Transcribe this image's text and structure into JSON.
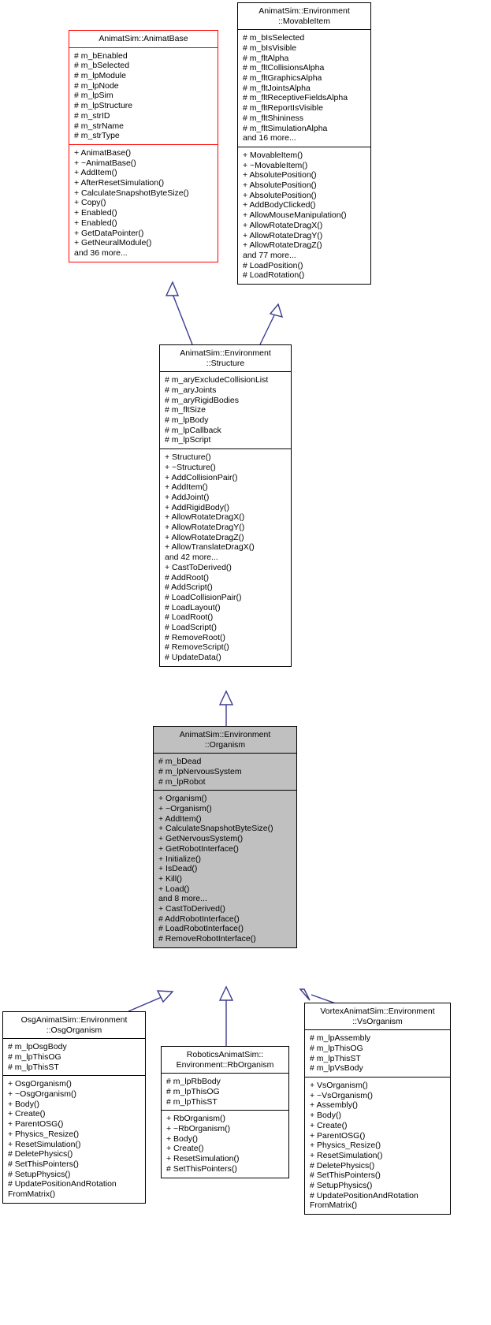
{
  "diagram": {
    "type": "uml-class-inheritance",
    "title": "AnimatSim Organism class hierarchy",
    "colors": {
      "highlight_border": "#ff0000",
      "highlight_fill": "#c0c0c0",
      "edge": "#3b3b8f",
      "box_border": "#000000",
      "box_fill": "#ffffff"
    }
  },
  "classes": [
    {
      "id": "animatbase",
      "name": "AnimatSim::AnimatBase",
      "style": "red-border",
      "attributes": [
        "# m_bEnabled",
        "# m_bSelected",
        "# m_lpModule",
        "# m_lpNode",
        "# m_lpSim",
        "# m_lpStructure",
        "# m_strID",
        "# m_strName",
        "# m_strType"
      ],
      "methods": [
        "+ AnimatBase()",
        "+ ~AnimatBase()",
        "+ AddItem()",
        "+ AfterResetSimulation()",
        "+ CalculateSnapshotByteSize()",
        "+ Copy()",
        "+ Enabled()",
        "+ Enabled()",
        "+ GetDataPointer()",
        "+ GetNeuralModule()",
        "and 36 more..."
      ]
    },
    {
      "id": "movableitem",
      "name": "AnimatSim::Environment\n::MovableItem",
      "style": "plain",
      "attributes": [
        "# m_bIsSelected",
        "# m_bIsVisible",
        "# m_fltAlpha",
        "# m_fltCollisionsAlpha",
        "# m_fltGraphicsAlpha",
        "# m_fltJointsAlpha",
        "# m_fltReceptiveFieldsAlpha",
        "# m_fltReportIsVisible",
        "# m_fltShininess",
        "# m_fltSimulationAlpha",
        "and 16 more..."
      ],
      "methods": [
        "+ MovableItem()",
        "+ ~MovableItem()",
        "+ AbsolutePosition()",
        "+ AbsolutePosition()",
        "+ AbsolutePosition()",
        "+ AddBodyClicked()",
        "+ AllowMouseManipulation()",
        "+ AllowRotateDragX()",
        "+ AllowRotateDragY()",
        "+ AllowRotateDragZ()",
        "and 77 more...",
        "# LoadPosition()",
        "# LoadRotation()"
      ]
    },
    {
      "id": "structure",
      "name": "AnimatSim::Environment\n::Structure",
      "style": "plain",
      "attributes": [
        "# m_aryExcludeCollisionList",
        "# m_aryJoints",
        "# m_aryRigidBodies",
        "# m_fltSize",
        "# m_lpBody",
        "# m_lpCallback",
        "# m_lpScript"
      ],
      "methods": [
        "+ Structure()",
        "+ ~Structure()",
        "+ AddCollisionPair()",
        "+ AddItem()",
        "+ AddJoint()",
        "+ AddRigidBody()",
        "+ AllowRotateDragX()",
        "+ AllowRotateDragY()",
        "+ AllowRotateDragZ()",
        "+ AllowTranslateDragX()",
        "and 42 more...",
        "+ CastToDerived()",
        "# AddRoot()",
        "# AddScript()",
        "# LoadCollisionPair()",
        "# LoadLayout()",
        "# LoadRoot()",
        "# LoadScript()",
        "# RemoveRoot()",
        "# RemoveScript()",
        "# UpdateData()"
      ]
    },
    {
      "id": "organism",
      "name": "AnimatSim::Environment\n::Organism",
      "style": "gray-fill",
      "attributes": [
        "# m_bDead",
        "# m_lpNervousSystem",
        "# m_lpRobot"
      ],
      "methods": [
        "+ Organism()",
        "+ ~Organism()",
        "+ AddItem()",
        "+ CalculateSnapshotByteSize()",
        "+ GetNervousSystem()",
        "+ GetRobotInterface()",
        "+ Initialize()",
        "+ IsDead()",
        "+ Kill()",
        "+ Load()",
        "and 8 more...",
        "+ CastToDerived()",
        "# AddRobotInterface()",
        "# LoadRobotInterface()",
        "# RemoveRobotInterface()"
      ]
    },
    {
      "id": "osgorganism",
      "name": "OsgAnimatSim::Environment\n::OsgOrganism",
      "style": "plain",
      "attributes": [
        "# m_lpOsgBody",
        "# m_lpThisOG",
        "# m_lpThisST"
      ],
      "methods": [
        "+ OsgOrganism()",
        "+ ~OsgOrganism()",
        "+ Body()",
        "+ Create()",
        "+ ParentOSG()",
        "+ Physics_Resize()",
        "+ ResetSimulation()",
        "# DeletePhysics()",
        "# SetThisPointers()",
        "# SetupPhysics()",
        "# UpdatePositionAndRotation",
        "FromMatrix()"
      ]
    },
    {
      "id": "rborganism",
      "name": "RoboticsAnimatSim::\nEnvironment::RbOrganism",
      "style": "plain",
      "attributes": [
        "# m_lpRbBody",
        "# m_lpThisOG",
        "# m_lpThisST"
      ],
      "methods": [
        "+ RbOrganism()",
        "+ ~RbOrganism()",
        "+ Body()",
        "+ Create()",
        "+ ResetSimulation()",
        "# SetThisPointers()"
      ]
    },
    {
      "id": "vsorganism",
      "name": "VortexAnimatSim::Environment\n::VsOrganism",
      "style": "plain",
      "attributes": [
        "# m_lpAssembly",
        "# m_lpThisOG",
        "# m_lpThisST",
        "# m_lpVsBody"
      ],
      "methods": [
        "+ VsOrganism()",
        "+ ~VsOrganism()",
        "+ Assembly()",
        "+ Body()",
        "+ Create()",
        "+ ParentOSG()",
        "+ Physics_Resize()",
        "+ ResetSimulation()",
        "# DeletePhysics()",
        "# SetThisPointers()",
        "# SetupPhysics()",
        "# UpdatePositionAndRotation",
        "FromMatrix()"
      ]
    }
  ],
  "edges": [
    {
      "from": "structure",
      "to": "animatbase",
      "kind": "generalization"
    },
    {
      "from": "structure",
      "to": "movableitem",
      "kind": "generalization"
    },
    {
      "from": "organism",
      "to": "structure",
      "kind": "generalization"
    },
    {
      "from": "osgorganism",
      "to": "organism",
      "kind": "generalization"
    },
    {
      "from": "rborganism",
      "to": "organism",
      "kind": "generalization"
    },
    {
      "from": "vsorganism",
      "to": "organism",
      "kind": "generalization"
    }
  ]
}
